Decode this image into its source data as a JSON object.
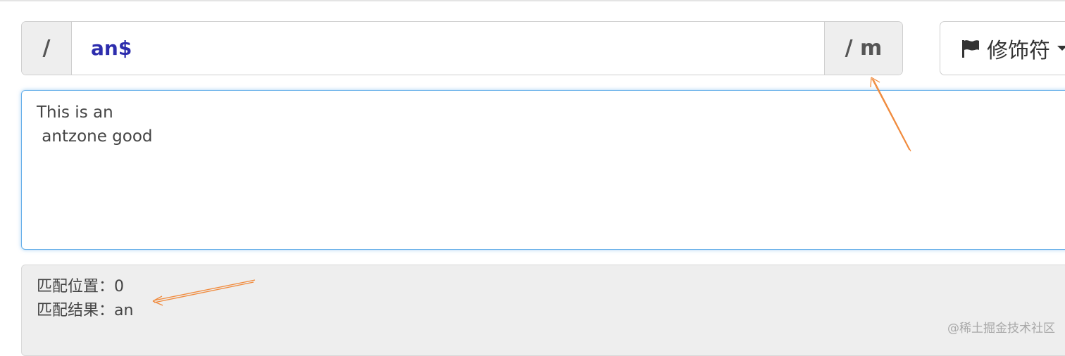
{
  "regex": {
    "open_delimiter": "/",
    "pattern": "an$",
    "close_delimiter": "/ m"
  },
  "modifier_button": {
    "label": "修饰符",
    "icon": "flag-icon"
  },
  "test_text": "This is an\n antzone good",
  "result": {
    "position_label": "匹配位置：",
    "position_value": "0",
    "match_label": "匹配结果：",
    "match_value": "an"
  },
  "watermark": "@稀土掘金技术社区",
  "colors": {
    "annotation_arrow": "#f08a3c",
    "pattern_text": "#2d2dad",
    "focus_border": "#66afe9",
    "addon_bg": "#eeeeee"
  }
}
